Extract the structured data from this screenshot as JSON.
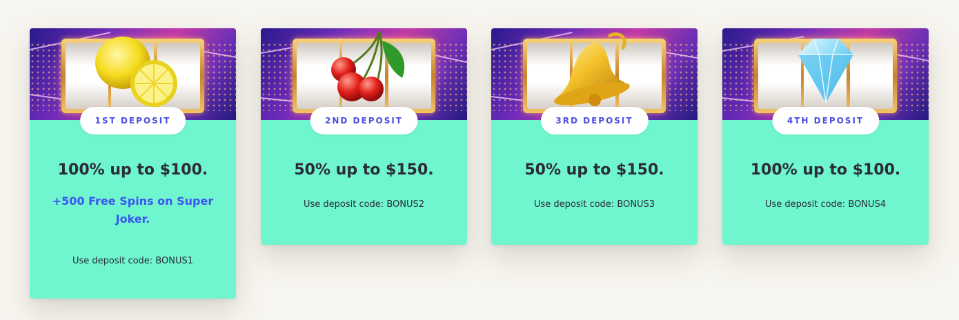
{
  "promotions": [
    {
      "badge": "1ST DEPOSIT",
      "offer": "100% up to $100.",
      "extra": "+500 Free Spins on Super Joker.",
      "code_text": "Use deposit code: BONUS1",
      "symbol": "lemon-icon"
    },
    {
      "badge": "2ND DEPOSIT",
      "offer": "50% up to $150.",
      "code_text": "Use deposit code: BONUS2",
      "symbol": "cherry-icon"
    },
    {
      "badge": "3RD DEPOSIT",
      "offer": "50% up to $150.",
      "code_text": "Use deposit code: BONUS3",
      "symbol": "bell-icon"
    },
    {
      "badge": "4TH DEPOSIT",
      "offer": "100% up to $100.",
      "code_text": "Use deposit code: BONUS4",
      "symbol": "diamond-icon"
    }
  ],
  "colors": {
    "card_background": "#6ff6cf",
    "badge_text": "#4a4fe0",
    "extra_text": "#3d55f0",
    "page_background": "#f7f5ef"
  }
}
